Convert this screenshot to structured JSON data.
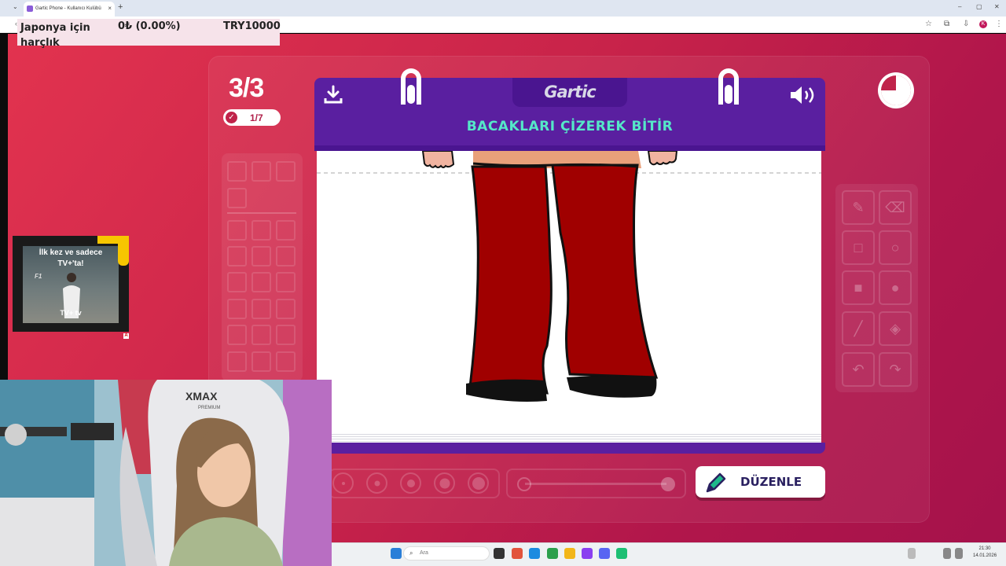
{
  "browser": {
    "tab_title": "Gartic Phone - Kullanıcı Kulübü",
    "new_tab": "+",
    "tab_close": "×",
    "dropdown": "⌄",
    "back": "‹",
    "profile_initial": "K",
    "window_controls": [
      "–",
      "▢",
      "✕"
    ]
  },
  "stock_widget": {
    "label": "Japonya için harçlık",
    "change": "0₺ (0.00%)",
    "value": "TRY10000"
  },
  "game": {
    "logo": "Gartic",
    "instruction": "BACAKLARI ÇİZEREK BİTİR",
    "round": "3/3",
    "done_count": "1/7",
    "edit_button": "DÜZENLE",
    "accent": "#5a1fa0",
    "instruction_color": "#55e8c8",
    "background": "#c8234a"
  },
  "tools": [
    "pencil-icon",
    "eraser-icon",
    "rectangle-outline-icon",
    "circle-outline-icon",
    "rectangle-fill-icon",
    "circle-fill-icon",
    "line-icon",
    "bucket-icon",
    "undo-icon",
    "redo-icon"
  ],
  "ad": {
    "line1": "İlk kez ve sadece",
    "line2": "TV+'ta!",
    "brand": "F1",
    "footer": "TV+  tv",
    "badge": "A"
  },
  "webcam": {
    "chair_brand": "XMAX",
    "chair_sub": "PREMIUM"
  },
  "taskbar": {
    "search_placeholder": "Ara",
    "time": "21:30",
    "date": "14.01.2026"
  }
}
